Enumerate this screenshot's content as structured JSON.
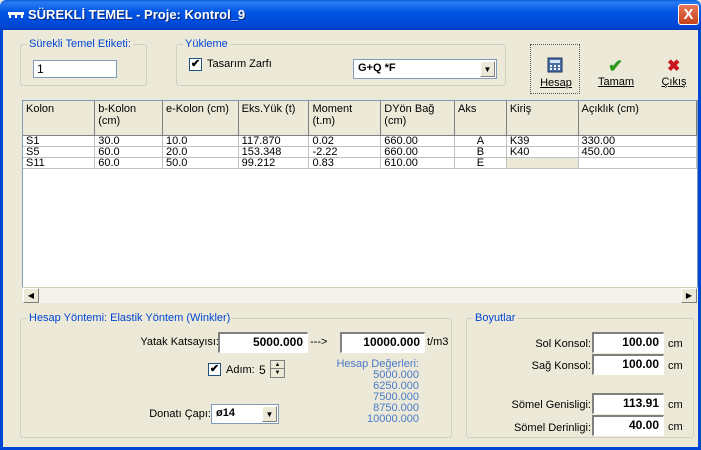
{
  "window": {
    "title": "SÜREKLİ TEMEL - Proje: Kontrol_9",
    "close_label": "X"
  },
  "top": {
    "label_group_title": "Sürekli Temel Etiketi:",
    "label_value": "1",
    "load_group_title": "Yükleme",
    "envelope_label": "Tasarım Zarfı",
    "envelope_checked": true,
    "combo_value": "G+Q *F"
  },
  "toolbar": {
    "hesap_label": "Hesap",
    "tamam_label": "Tamam",
    "cikis_label": "Çıkış"
  },
  "grid": {
    "columns": [
      "Kolon",
      "b-Kolon (cm)",
      "e-Kolon (cm)",
      "Eks.Yük (t)",
      "Moment (t.m)",
      "DYön Bağ (cm)",
      "Aks",
      "Kiriş",
      "Açıklık (cm)"
    ],
    "rows": [
      [
        "S1",
        "30.0",
        "10.0",
        "117.870",
        "0.02",
        "660.00",
        "A",
        "K39",
        "330.00"
      ],
      [
        "S5",
        "60.0",
        "20.0",
        "153.348",
        "-2.22",
        "660.00",
        "B",
        "K40",
        "450.00"
      ],
      [
        "S11",
        "60.0",
        "50.0",
        "99.212",
        "0.83",
        "610.00",
        "E",
        "",
        ""
      ]
    ]
  },
  "method": {
    "group_title": "Hesap Yöntemi: Elastik Yöntem (Winkler)",
    "yatak_label": "Yatak Katsayısı:",
    "yatak_from": "5000.000",
    "arrow": "--->",
    "yatak_to": "10000.000",
    "unit": "t/m3",
    "adim_label": "Adım:",
    "adim_value": "5",
    "adim_checked": true,
    "donati_label": "Donatı Çapı:",
    "donati_value": "ø14",
    "hesap_values_title": "Hesap Değerleri:",
    "hesap_values": [
      "5000.000",
      "6250.000",
      "7500.000",
      "8750.000",
      "10000.000"
    ]
  },
  "dims": {
    "group_title": "Boyutlar",
    "sol_label": "Sol Konsol:",
    "sol_value": "100.00",
    "sag_label": "Sağ Konsol:",
    "sag_value": "100.00",
    "genislik_label": "Sömel Genisligi:",
    "genislik_value": "113.91",
    "derinlik_label": "Sömel Derinligi:",
    "derinlik_value": "40.00",
    "unit": "cm"
  }
}
